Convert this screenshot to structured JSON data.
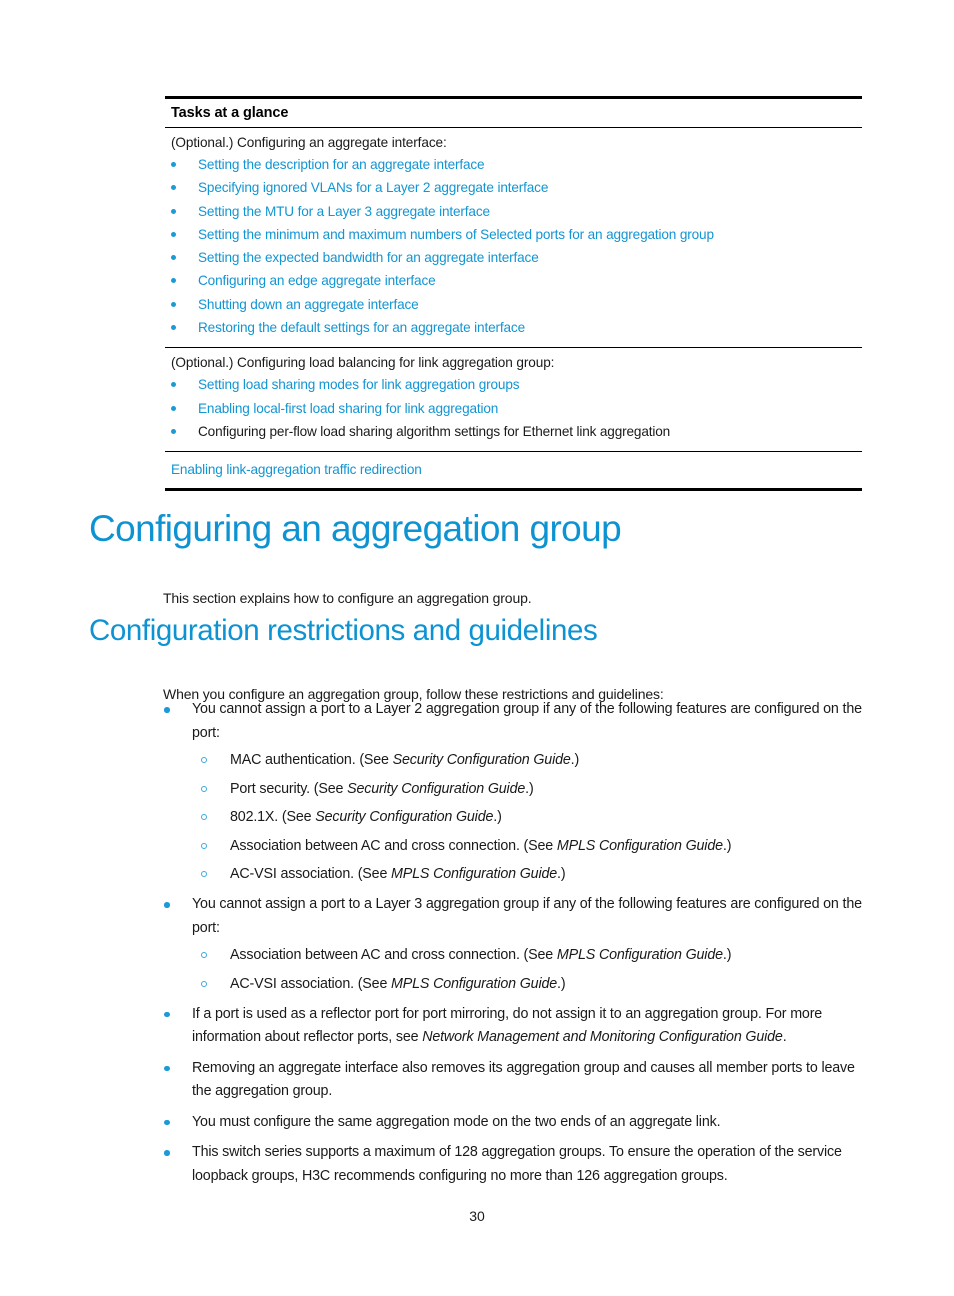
{
  "colors": {
    "link": "#1295d3",
    "heading": "#0d93d2",
    "bullet": "#1c9ad6",
    "text": "#1a1a1a",
    "rule": "#000000"
  },
  "tasks_table": {
    "header": "Tasks at a glance",
    "sections": [
      {
        "intro": "(Optional.) Configuring an aggregate interface:",
        "items": [
          {
            "text": "Setting the description for an aggregate interface",
            "link": true
          },
          {
            "text": "Specifying ignored VLANs for a Layer 2 aggregate interface",
            "link": true
          },
          {
            "text": "Setting the MTU for a Layer 3 aggregate interface",
            "link": true
          },
          {
            "text": "Setting the minimum and maximum numbers of Selected ports for an aggregation group",
            "link": true
          },
          {
            "text": "Setting the expected bandwidth for an aggregate interface",
            "link": true
          },
          {
            "text": "Configuring an edge aggregate interface",
            "link": true
          },
          {
            "text": "Shutting down an aggregate interface",
            "link": true
          },
          {
            "text": "Restoring the default settings for an aggregate interface",
            "link": true
          }
        ]
      },
      {
        "intro": "(Optional.) Configuring load balancing for link aggregation group:",
        "items": [
          {
            "text": "Setting load sharing modes for link aggregation groups",
            "link": true
          },
          {
            "text": "Enabling local-first load sharing for link aggregation",
            "link": true
          },
          {
            "text": "Configuring per-flow load sharing algorithm settings for Ethernet link aggregation",
            "link": false
          }
        ]
      }
    ],
    "final_row": "Enabling link-aggregation traffic redirection"
  },
  "headings": {
    "h1": "Configuring an aggregation group",
    "h1_intro": "This section explains how to configure an aggregation group.",
    "h2": "Configuration restrictions and guidelines",
    "h2_intro": "When you configure an aggregation group, follow these restrictions and guidelines:"
  },
  "guidelines": [
    {
      "text": "You cannot assign a port to a Layer 2 aggregation group if any of the following features are configured on the port:",
      "sub": [
        {
          "pre": "MAC authentication. (See ",
          "ital": "Security Configuration Guide",
          "post": ".)"
        },
        {
          "pre": "Port security. (See ",
          "ital": "Security Configuration Guide",
          "post": ".)"
        },
        {
          "pre": "802.1X. (See ",
          "ital": "Security Configuration Guide",
          "post": ".)"
        },
        {
          "pre": "Association between AC and cross connection. (See ",
          "ital": "MPLS Configuration Guide",
          "post": ".)"
        },
        {
          "pre": "AC-VSI association. (See ",
          "ital": "MPLS Configuration Guide",
          "post": ".)"
        }
      ]
    },
    {
      "text": "You cannot assign a port to a Layer 3 aggregation group if any of the following features are configured on the port:",
      "sub": [
        {
          "pre": "Association between AC and cross connection. (See ",
          "ital": "MPLS Configuration Guide",
          "post": ".)"
        },
        {
          "pre": "AC-VSI association. (See ",
          "ital": "MPLS Configuration Guide",
          "post": ".)"
        }
      ]
    },
    {
      "pre": "If a port is used as a reflector port for port mirroring, do not assign it to an aggregation group. For more information about reflector ports, see ",
      "ital": "Network Management and Monitoring Configuration Guide",
      "post": ".",
      "sub": []
    },
    {
      "text": "Removing an aggregate interface also removes its aggregation group and causes all member ports to leave the aggregation group.",
      "sub": []
    },
    {
      "text": "You must configure the same aggregation mode on the two ends of an aggregate link.",
      "sub": []
    },
    {
      "text": "This switch series supports a maximum of 128 aggregation groups. To ensure the operation of the service loopback groups, H3C recommends configuring no more than 126 aggregation groups.",
      "sub": []
    }
  ],
  "footer": {
    "page_number": "30"
  }
}
